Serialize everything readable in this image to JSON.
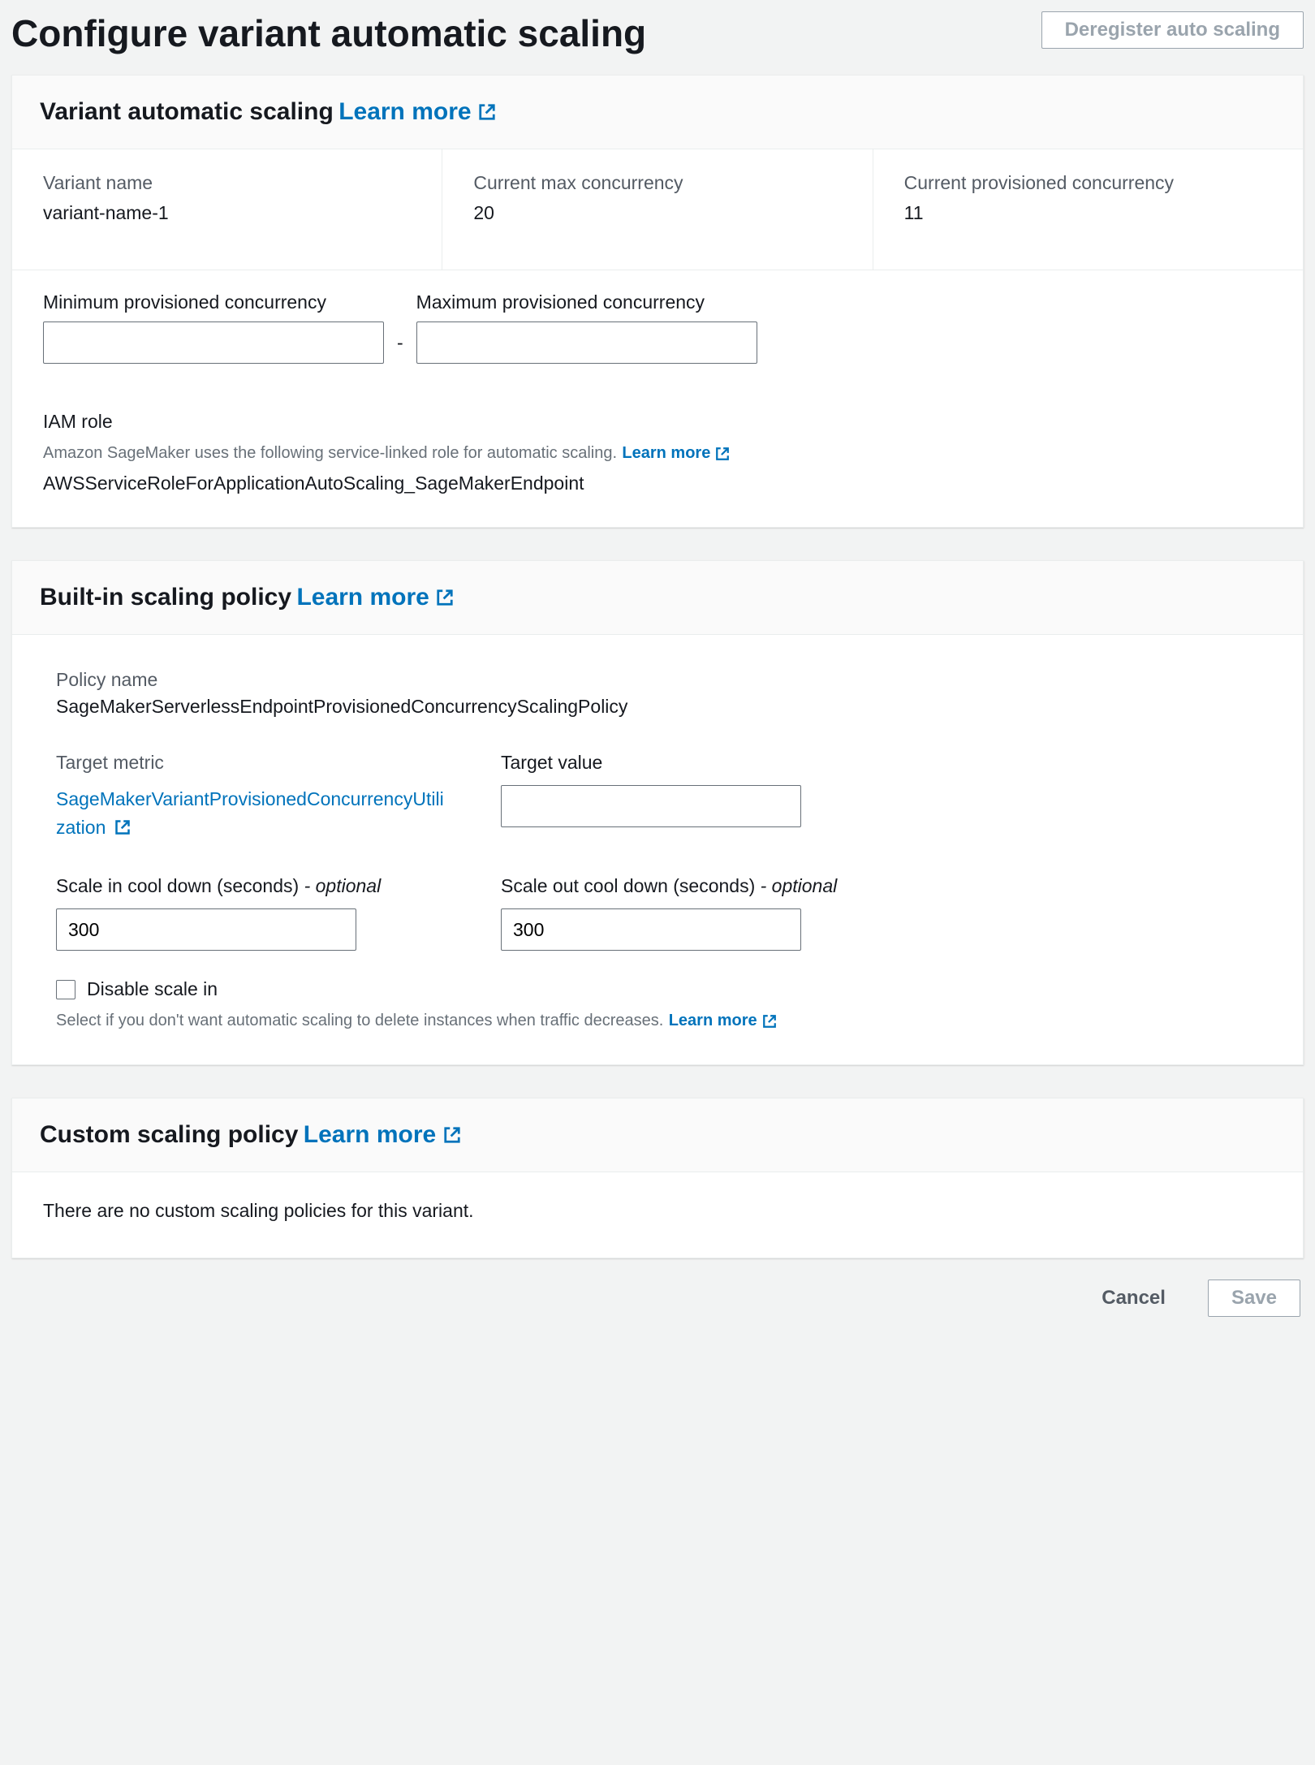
{
  "page": {
    "title": "Configure variant automatic scaling",
    "deregister_label": "Deregister auto scaling"
  },
  "variant_panel": {
    "title": "Variant automatic scaling",
    "learn_more": "Learn more",
    "fields": {
      "variant_name_label": "Variant name",
      "variant_name_value": "variant-name-1",
      "current_max_label": "Current max concurrency",
      "current_max_value": "20",
      "current_prov_label": "Current provisioned concurrency",
      "current_prov_value": "11"
    },
    "min_label": "Minimum provisioned concurrency",
    "max_label": "Maximum provisioned concurrency",
    "min_value": "",
    "max_value": "",
    "iam_label": "IAM role",
    "iam_hint": "Amazon SageMaker uses the following service-linked role for automatic scaling.",
    "iam_learn_more": "Learn more",
    "iam_value": "AWSServiceRoleForApplicationAutoScaling_SageMakerEndpoint"
  },
  "builtin_panel": {
    "title": "Built-in scaling policy",
    "learn_more": "Learn more",
    "policy_name_label": "Policy name",
    "policy_name_value": "SageMakerServerlessEndpointProvisionedConcurrencyScalingPolicy",
    "target_metric_label": "Target metric",
    "target_metric_value": "SageMakerVariantProvisionedConcurrencyUtilization",
    "target_value_label": "Target value",
    "target_value": "",
    "scale_in_label": "Scale in cool down (seconds)",
    "scale_out_label": "Scale out cool down (seconds)",
    "optional_suffix": "- optional",
    "scale_in_value": "300",
    "scale_out_value": "300",
    "disable_label": "Disable scale in",
    "disable_hint": "Select if you don't want automatic scaling to delete instances when traffic decreases.",
    "disable_learn_more": "Learn more"
  },
  "custom_panel": {
    "title": "Custom scaling policy",
    "learn_more": "Learn more",
    "empty_msg": "There are no custom scaling policies for this variant."
  },
  "footer": {
    "cancel": "Cancel",
    "save": "Save"
  }
}
